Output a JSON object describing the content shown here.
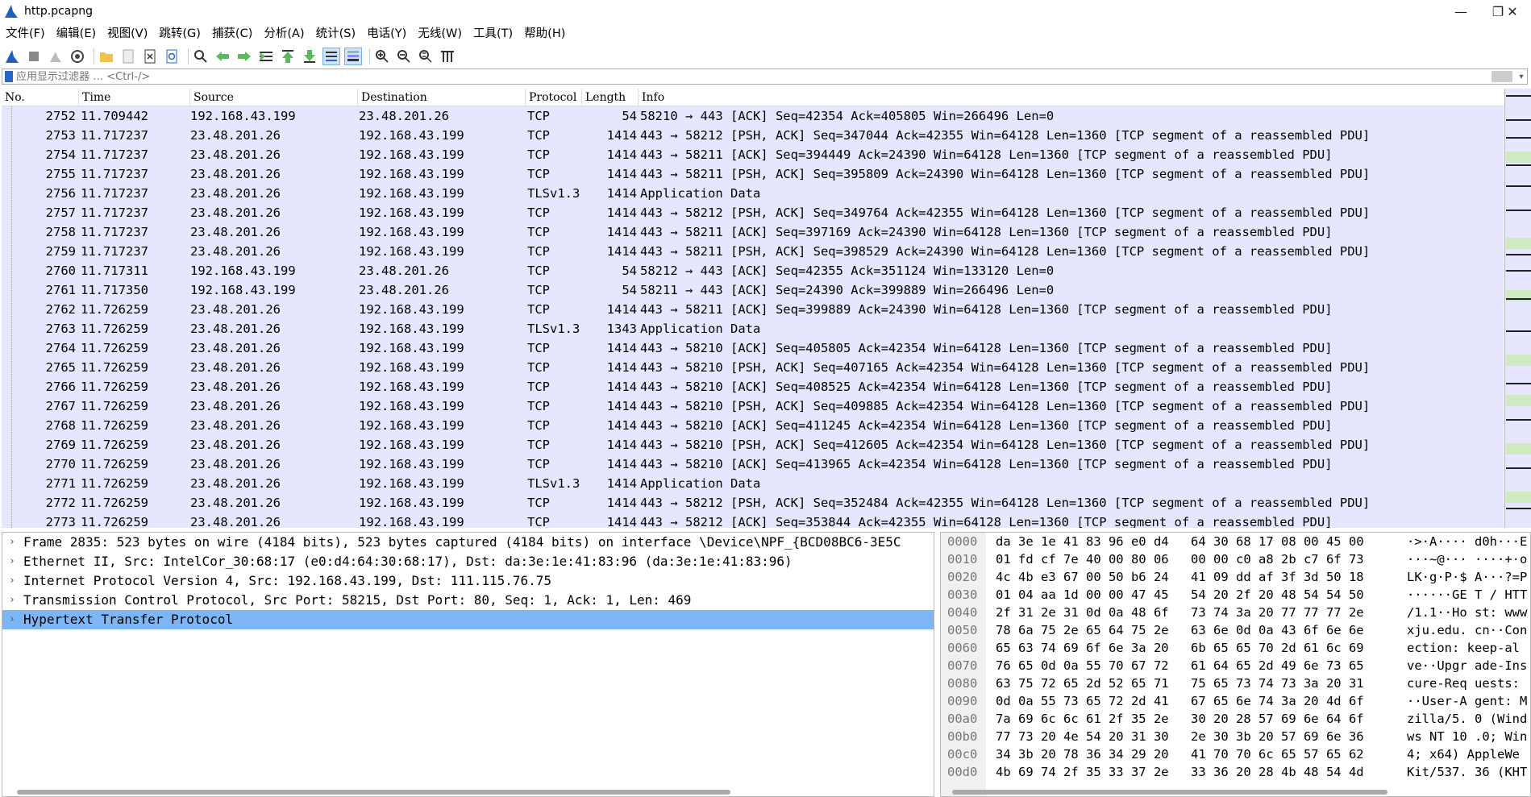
{
  "window": {
    "title": "http.pcapng",
    "controls": [
      "—",
      "❐",
      "✕"
    ]
  },
  "menu": [
    "文件(F)",
    "编辑(E)",
    "视图(V)",
    "跳转(G)",
    "捕获(C)",
    "分析(A)",
    "统计(S)",
    "电话(Y)",
    "无线(W)",
    "工具(T)",
    "帮助(H)"
  ],
  "filter": {
    "placeholder": "应用显示过滤器 … <Ctrl-/>"
  },
  "packet_list": {
    "columns": [
      "No.",
      "Time",
      "Source",
      "Destination",
      "Protocol",
      "Length",
      "Info"
    ],
    "rows": [
      [
        "2752",
        "11.709442",
        "192.168.43.199",
        "23.48.201.26",
        "TCP",
        "54",
        "58210 → 443 [ACK] Seq=42354 Ack=405805 Win=266496 Len=0"
      ],
      [
        "2753",
        "11.717237",
        "23.48.201.26",
        "192.168.43.199",
        "TCP",
        "1414",
        "443 → 58212 [PSH, ACK] Seq=347044 Ack=42355 Win=64128 Len=1360 [TCP segment of a reassembled PDU]"
      ],
      [
        "2754",
        "11.717237",
        "23.48.201.26",
        "192.168.43.199",
        "TCP",
        "1414",
        "443 → 58211 [ACK] Seq=394449 Ack=24390 Win=64128 Len=1360 [TCP segment of a reassembled PDU]"
      ],
      [
        "2755",
        "11.717237",
        "23.48.201.26",
        "192.168.43.199",
        "TCP",
        "1414",
        "443 → 58211 [PSH, ACK] Seq=395809 Ack=24390 Win=64128 Len=1360 [TCP segment of a reassembled PDU]"
      ],
      [
        "2756",
        "11.717237",
        "23.48.201.26",
        "192.168.43.199",
        "TLSv1.3",
        "1414",
        "Application Data"
      ],
      [
        "2757",
        "11.717237",
        "23.48.201.26",
        "192.168.43.199",
        "TCP",
        "1414",
        "443 → 58212 [PSH, ACK] Seq=349764 Ack=42355 Win=64128 Len=1360 [TCP segment of a reassembled PDU]"
      ],
      [
        "2758",
        "11.717237",
        "23.48.201.26",
        "192.168.43.199",
        "TCP",
        "1414",
        "443 → 58211 [ACK] Seq=397169 Ack=24390 Win=64128 Len=1360 [TCP segment of a reassembled PDU]"
      ],
      [
        "2759",
        "11.717237",
        "23.48.201.26",
        "192.168.43.199",
        "TCP",
        "1414",
        "443 → 58211 [PSH, ACK] Seq=398529 Ack=24390 Win=64128 Len=1360 [TCP segment of a reassembled PDU]"
      ],
      [
        "2760",
        "11.717311",
        "192.168.43.199",
        "23.48.201.26",
        "TCP",
        "54",
        "58212 → 443 [ACK] Seq=42355 Ack=351124 Win=133120 Len=0"
      ],
      [
        "2761",
        "11.717350",
        "192.168.43.199",
        "23.48.201.26",
        "TCP",
        "54",
        "58211 → 443 [ACK] Seq=24390 Ack=399889 Win=266496 Len=0"
      ],
      [
        "2762",
        "11.726259",
        "23.48.201.26",
        "192.168.43.199",
        "TCP",
        "1414",
        "443 → 58211 [ACK] Seq=399889 Ack=24390 Win=64128 Len=1360 [TCP segment of a reassembled PDU]"
      ],
      [
        "2763",
        "11.726259",
        "23.48.201.26",
        "192.168.43.199",
        "TLSv1.3",
        "1343",
        "Application Data"
      ],
      [
        "2764",
        "11.726259",
        "23.48.201.26",
        "192.168.43.199",
        "TCP",
        "1414",
        "443 → 58210 [ACK] Seq=405805 Ack=42354 Win=64128 Len=1360 [TCP segment of a reassembled PDU]"
      ],
      [
        "2765",
        "11.726259",
        "23.48.201.26",
        "192.168.43.199",
        "TCP",
        "1414",
        "443 → 58210 [PSH, ACK] Seq=407165 Ack=42354 Win=64128 Len=1360 [TCP segment of a reassembled PDU]"
      ],
      [
        "2766",
        "11.726259",
        "23.48.201.26",
        "192.168.43.199",
        "TCP",
        "1414",
        "443 → 58210 [ACK] Seq=408525 Ack=42354 Win=64128 Len=1360 [TCP segment of a reassembled PDU]"
      ],
      [
        "2767",
        "11.726259",
        "23.48.201.26",
        "192.168.43.199",
        "TCP",
        "1414",
        "443 → 58210 [PSH, ACK] Seq=409885 Ack=42354 Win=64128 Len=1360 [TCP segment of a reassembled PDU]"
      ],
      [
        "2768",
        "11.726259",
        "23.48.201.26",
        "192.168.43.199",
        "TCP",
        "1414",
        "443 → 58210 [ACK] Seq=411245 Ack=42354 Win=64128 Len=1360 [TCP segment of a reassembled PDU]"
      ],
      [
        "2769",
        "11.726259",
        "23.48.201.26",
        "192.168.43.199",
        "TCP",
        "1414",
        "443 → 58210 [PSH, ACK] Seq=412605 Ack=42354 Win=64128 Len=1360 [TCP segment of a reassembled PDU]"
      ],
      [
        "2770",
        "11.726259",
        "23.48.201.26",
        "192.168.43.199",
        "TCP",
        "1414",
        "443 → 58210 [ACK] Seq=413965 Ack=42354 Win=64128 Len=1360 [TCP segment of a reassembled PDU]"
      ],
      [
        "2771",
        "11.726259",
        "23.48.201.26",
        "192.168.43.199",
        "TLSv1.3",
        "1414",
        "Application Data"
      ],
      [
        "2772",
        "11.726259",
        "23.48.201.26",
        "192.168.43.199",
        "TCP",
        "1414",
        "443 → 58212 [PSH, ACK] Seq=352484 Ack=42355 Win=64128 Len=1360 [TCP segment of a reassembled PDU]"
      ],
      [
        "2773",
        "11.726259",
        "23.48.201.26",
        "192.168.43.199",
        "TCP",
        "1414",
        "443 → 58212 [ACK] Seq=353844 Ack=42355 Win=64128 Len=1360 [TCP segment of a reassembled PDU]"
      ]
    ]
  },
  "details": {
    "selected_index": 4,
    "rows": [
      "Frame 2835: 523 bytes on wire (4184 bits), 523 bytes captured (4184 bits) on interface \\Device\\NPF_{BCD08BC6-3E5C",
      "Ethernet II, Src: IntelCor_30:68:17 (e0:d4:64:30:68:17), Dst: da:3e:1e:41:83:96 (da:3e:1e:41:83:96)",
      "Internet Protocol Version 4, Src: 192.168.43.199, Dst: 111.115.76.75",
      "Transmission Control Protocol, Src Port: 58215, Dst Port: 80, Seq: 1, Ack: 1, Len: 469",
      "Hypertext Transfer Protocol"
    ]
  },
  "bytes": {
    "rows": [
      [
        "0000",
        "da 3e 1e 41 83 96 e0 d4",
        "64 30 68 17 08 00 45 00",
        "·>·A····  d0h···E"
      ],
      [
        "0010",
        "01 fd cf 7e 40 00 80 06",
        "00 00 c0 a8 2b c7 6f 73",
        "···~@···  ····+·o"
      ],
      [
        "0020",
        "4c 4b e3 67 00 50 b6 24",
        "41 09 dd af 3f 3d 50 18",
        "LK·g·P·$  A···?=P"
      ],
      [
        "0030",
        "01 04 aa 1d 00 00 47 45",
        "54 20 2f 20 48 54 54 50",
        "······GE  T / HTT"
      ],
      [
        "0040",
        "2f 31 2e 31 0d 0a 48 6f",
        "73 74 3a 20 77 77 77 2e",
        "/1.1··Ho  st: www"
      ],
      [
        "0050",
        "78 6a 75 2e 65 64 75 2e",
        "63 6e 0d 0a 43 6f 6e 6e",
        "xju.edu.  cn··Con"
      ],
      [
        "0060",
        "65 63 74 69 6f 6e 3a 20",
        "6b 65 65 70 2d 61 6c 69",
        "ection:   keep-al"
      ],
      [
        "0070",
        "76 65 0d 0a 55 70 67 72",
        "61 64 65 2d 49 6e 73 65",
        "ve··Upgr  ade-Ins"
      ],
      [
        "0080",
        "63 75 72 65 2d 52 65 71",
        "75 65 73 74 73 3a 20 31",
        "cure-Req  uests: "
      ],
      [
        "0090",
        "0d 0a 55 73 65 72 2d 41",
        "67 65 6e 74 3a 20 4d 6f",
        "··User-A  gent: M"
      ],
      [
        "00a0",
        "7a 69 6c 6c 61 2f 35 2e",
        "30 20 28 57 69 6e 64 6f",
        "zilla/5.  0 (Wind"
      ],
      [
        "00b0",
        "77 73 20 4e 54 20 31 30",
        "2e 30 3b 20 57 69 6e 36",
        "ws NT 10  .0; Win"
      ],
      [
        "00c0",
        "34 3b 20 78 36 34 29 20",
        "41 70 70 6c 65 57 65 62",
        "4; x64)   AppleWe"
      ],
      [
        "00d0",
        "4b 69 74 2f 35 33 37 2e",
        "33 36 20 28 4b 48 54 4d",
        "Kit/537.  36 (KHT"
      ]
    ]
  }
}
